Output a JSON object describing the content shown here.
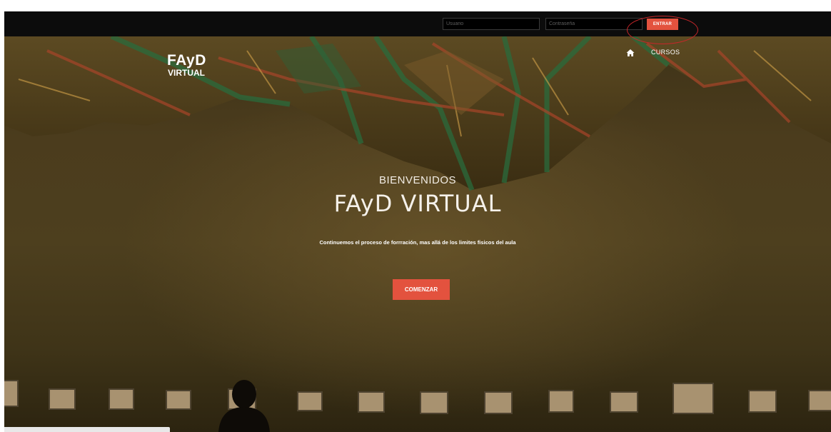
{
  "login": {
    "username_placeholder": "Usuario",
    "password_placeholder": "Contraseña",
    "submit_label": "ENTRAR"
  },
  "brand": {
    "line1": "FAyD",
    "line2": "VIRTUAL"
  },
  "nav": {
    "home_icon": "home-icon",
    "cursos_label": "CURSOS"
  },
  "hero": {
    "greeting": "BIENVENIDOS",
    "title": "FAyD VIRTUAL",
    "tagline": "Continuemos el proceso de forrración, mas allá de los limites fisicos del aula",
    "cta_label": "COMENZAR"
  },
  "colors": {
    "accent": "#e3523e",
    "topbar": "#0c0c0c",
    "highlight_ring": "#c9262a"
  }
}
